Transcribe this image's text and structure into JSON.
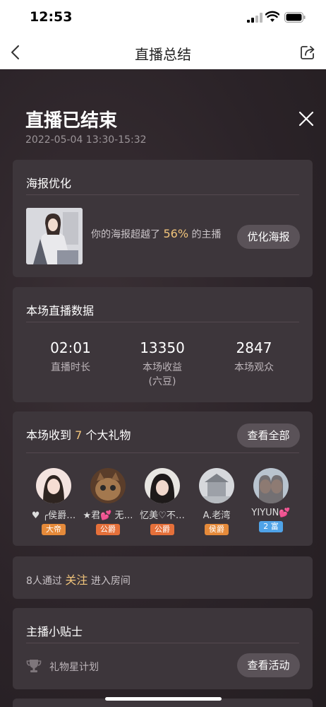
{
  "status": {
    "time": "12:53"
  },
  "nav": {
    "title": "直播总结"
  },
  "header": {
    "title": "直播已结束",
    "time": "2022-05-04 13:30-15:32"
  },
  "poster_card": {
    "title": "海报优化",
    "text_prefix": "你的海报超越了 ",
    "percent": "56%",
    "text_suffix": " 的主播",
    "button": "优化海报"
  },
  "stats_card": {
    "title": "本场直播数据",
    "stats": [
      {
        "value": "02:01",
        "label": "直播时长",
        "sub": ""
      },
      {
        "value": "13350",
        "label": "本场收益",
        "sub": "(六豆)"
      },
      {
        "value": "2847",
        "label": "本场观众",
        "sub": ""
      }
    ]
  },
  "gifts_card": {
    "title_prefix": "本场收到 ",
    "count": "7",
    "title_suffix": " 个大礼物",
    "button": "查看全部",
    "users": [
      {
        "name": "♥ ╭侯爵…",
        "badge": "大帝",
        "badge_color": "#e58a3a"
      },
      {
        "name": "★君💕 无…",
        "badge": "公爵",
        "badge_color": "#e5703a"
      },
      {
        "name": "忆美♡不…",
        "badge": "公爵",
        "badge_color": "#e5703a"
      },
      {
        "name": "A.老湾",
        "badge": "侯爵",
        "badge_color": "#e58a3a"
      },
      {
        "name": "YIYUN💕",
        "badge": "2 富",
        "badge_color": "#4fa3e8"
      }
    ]
  },
  "follow_card": {
    "text_prefix": "8人通过 ",
    "highlight": "关注",
    "text_suffix": " 进入房间"
  },
  "tips_card": {
    "title": "主播小贴士",
    "item_label": "礼物星计划",
    "button": "查看活动"
  }
}
